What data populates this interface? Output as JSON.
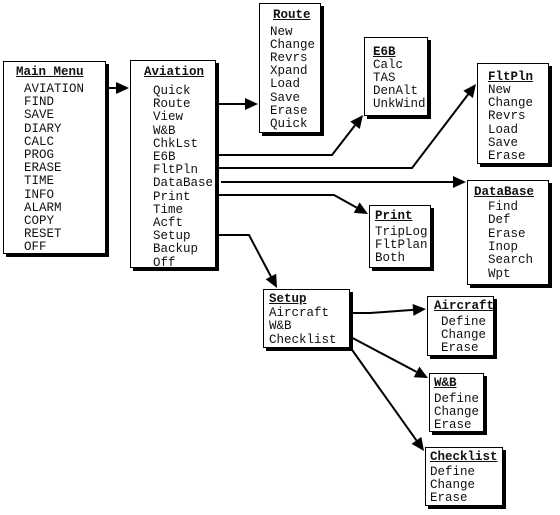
{
  "menus": {
    "main": {
      "title": "Main Menu",
      "items": [
        "AVIATION",
        "FIND",
        "SAVE",
        "DIARY",
        "CALC",
        "PROG",
        "ERASE",
        "TIME",
        "INFO",
        "ALARM",
        "COPY",
        "RESET",
        "OFF"
      ]
    },
    "aviation": {
      "title": "Aviation",
      "items": [
        "Quick",
        "Route",
        "View",
        "W&B",
        "ChkLst",
        "E6B",
        "FltPln",
        "DataBase",
        "Print",
        "Time",
        "Acft",
        "Setup",
        "Backup",
        "Off"
      ]
    },
    "route": {
      "title": "Route",
      "items": [
        "New",
        "Change",
        "Revrs",
        "Xpand",
        "Load",
        "Save",
        "Erase",
        "Quick"
      ]
    },
    "e6b": {
      "title": "E6B",
      "items": [
        "Calc",
        "TAS",
        "DenAlt",
        "UnkWind"
      ]
    },
    "fltpln": {
      "title": "FltPln",
      "items": [
        "New",
        "Change",
        "Revrs",
        "Load",
        "Save",
        "Erase"
      ]
    },
    "database": {
      "title": "DataBase",
      "items": [
        "Find",
        "Def",
        "Erase",
        "Inop",
        "Search",
        "Wpt"
      ]
    },
    "print": {
      "title": "Print",
      "items": [
        "TripLog",
        "FltPlan",
        "Both"
      ]
    },
    "setup": {
      "title": "Setup",
      "items": [
        "Aircraft",
        "W&B",
        "Checklist"
      ]
    },
    "aircraft": {
      "title": "Aircraft",
      "items": [
        "Define",
        "Change",
        "Erase"
      ]
    },
    "wb": {
      "title": "W&B",
      "items": [
        "Define",
        "Change",
        "Erase"
      ]
    },
    "checklist": {
      "title": "Checklist",
      "items": [
        "Define",
        "Change",
        "Erase"
      ]
    }
  },
  "connections": [
    {
      "from": "main.AVIATION",
      "to": "aviation"
    },
    {
      "from": "aviation.Route",
      "to": "route"
    },
    {
      "from": "aviation.E6B",
      "to": "e6b"
    },
    {
      "from": "aviation.FltPln",
      "to": "fltpln"
    },
    {
      "from": "aviation.DataBase",
      "to": "database"
    },
    {
      "from": "aviation.Print",
      "to": "print"
    },
    {
      "from": "aviation.Setup",
      "to": "setup"
    },
    {
      "from": "setup.Aircraft",
      "to": "aircraft"
    },
    {
      "from": "setup.W&B",
      "to": "wb"
    },
    {
      "from": "setup.Checklist",
      "to": "checklist"
    }
  ]
}
